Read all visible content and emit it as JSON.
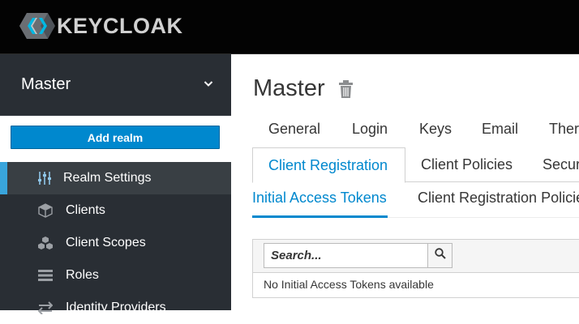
{
  "header": {
    "logo_text": "KEYCLOAK",
    "logo_icon": "keycloak-logo-icon"
  },
  "sidebar": {
    "realm": {
      "name": "Master",
      "icon": "chevron-down-icon"
    },
    "add_realm_label": "Add realm",
    "items": [
      {
        "label": "Realm Settings",
        "icon": "sliders-icon",
        "active": true
      },
      {
        "label": "Clients",
        "icon": "cube-icon",
        "active": false
      },
      {
        "label": "Client Scopes",
        "icon": "cubes-icon",
        "active": false
      },
      {
        "label": "Roles",
        "icon": "list-icon",
        "active": false
      },
      {
        "label": "Identity Providers",
        "icon": "exchange-icon",
        "active": false
      }
    ]
  },
  "main": {
    "title": "Master",
    "title_icon": "trash-icon",
    "tabs_row1": [
      "General",
      "Login",
      "Keys",
      "Email",
      "Ther"
    ],
    "tabs_row2": [
      "Client Registration",
      "Client Policies",
      "Secur"
    ],
    "tabs_row3": [
      "Initial Access Tokens",
      "Client Registration Policie"
    ],
    "search": {
      "placeholder": "Search...",
      "icon": "search-icon"
    },
    "empty_message": "No Initial Access Tokens available"
  },
  "colors": {
    "header_bg": "#030303",
    "sidebar_bg": "#292e34",
    "accent": "#0088ce",
    "active_indicator": "#39a5dc"
  }
}
